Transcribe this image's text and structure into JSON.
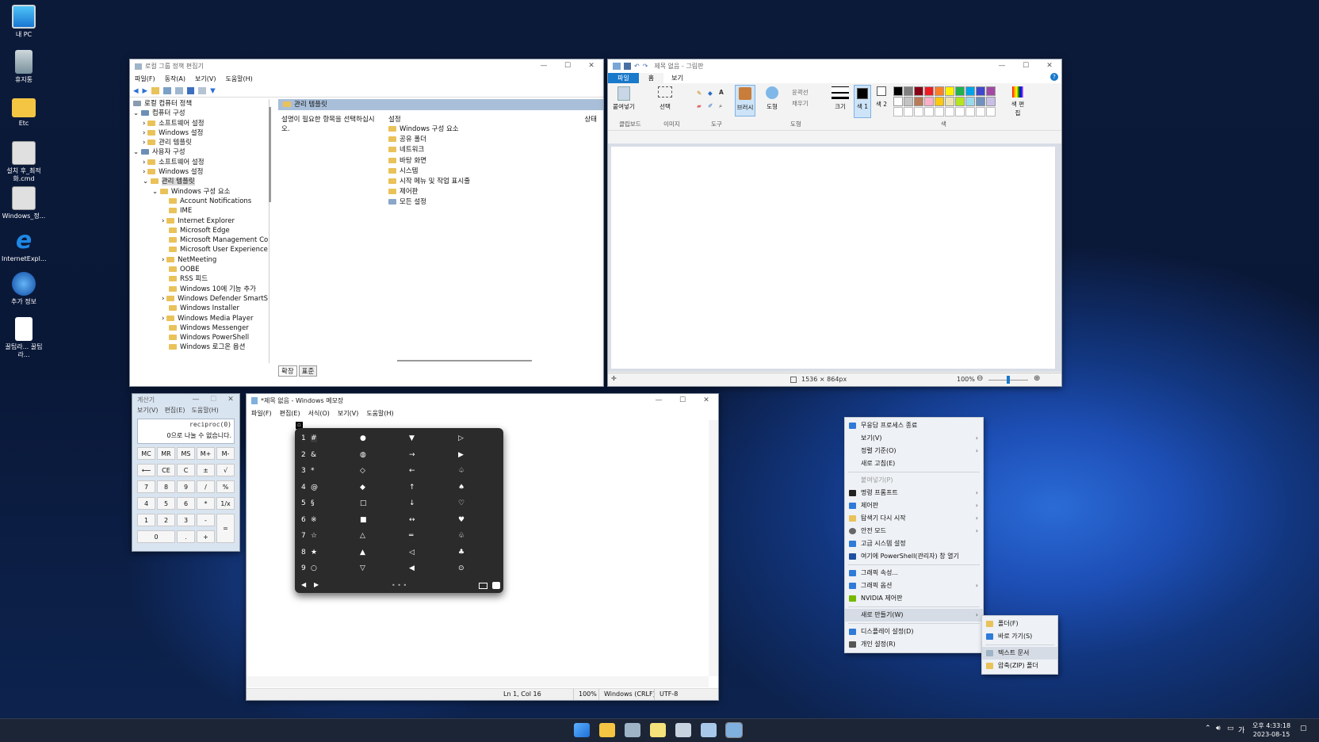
{
  "desktop": {
    "icons": [
      "내 PC",
      "휴지통",
      "Etc",
      "설치 후_최적화.cmd",
      "Windows_정...",
      "InternetExpl...",
      "추가 정보",
      "꿀팁라... 꿀팁라..."
    ]
  },
  "gpedit": {
    "title": "로컬 그룹 정책 편집기",
    "menu": [
      "파일(F)",
      "동작(A)",
      "보기(V)",
      "도움말(H)"
    ],
    "tree": [
      "로컬 컴퓨터 정책",
      "컴퓨터 구성",
      "소프트웨어 설정",
      "Windows 설정",
      "관리 템플릿",
      "사용자 구성",
      "소프트웨어 설정",
      "Windows 설정",
      "관리 템플릿",
      "Windows 구성 요소",
      "Account Notifications",
      "IME",
      "Internet Explorer",
      "Microsoft Edge",
      "Microsoft Management Co",
      "Microsoft User Experience",
      "NetMeeting",
      "OOBE",
      "RSS 피드",
      "Windows 10에 기능 추가",
      "Windows Defender SmartS",
      "Windows Installer",
      "Windows Media Player",
      "Windows Messenger",
      "Windows PowerShell",
      "Windows 로그온 옵션"
    ],
    "header": "관리 템플릿",
    "description": "설명이 필요한 항목을 선택하십시오.",
    "col_setting": "설정",
    "col_state": "상태",
    "items": [
      "Windows 구성 요소",
      "공유 폴더",
      "네트워크",
      "바탕 화면",
      "시스템",
      "시작 메뉴 및 작업 표시줄",
      "제어판",
      "모든 설정"
    ],
    "tabs": [
      "확장",
      "표준"
    ]
  },
  "paint": {
    "title": "제목 없음 - 그림판",
    "tabs": [
      "파일",
      "홈",
      "보기"
    ],
    "groups": [
      "클립보드",
      "이미지",
      "도구",
      "도형",
      "색"
    ],
    "labels": {
      "paste": "붙여넣기",
      "select": "선택",
      "brush": "브러시",
      "shape": "도형",
      "outline": "윤곽선",
      "fill": "채우기",
      "size": "크기",
      "color1": "색 1",
      "color2": "색 2",
      "edit": "색 편집"
    },
    "palette": [
      "#000000",
      "#7f7f7f",
      "#880015",
      "#ed1c24",
      "#ff7f27",
      "#fff200",
      "#22b14c",
      "#00a2e8",
      "#3f48cc",
      "#a349a4",
      "#ffffff",
      "#c3c3c3",
      "#b97a57",
      "#ffaec9",
      "#ffc90e",
      "#efe4b0",
      "#b5e61d",
      "#99d9ea",
      "#7092be",
      "#c8bfe7"
    ],
    "status": {
      "dimensions": "1536 × 864px",
      "zoom": "100%"
    }
  },
  "calc": {
    "title": "계산기",
    "menu": [
      "보기(V)",
      "편집(E)",
      "도움말(H)"
    ],
    "expr": "reciproc(0)",
    "result": "0으로 나눌 수 없습니다.",
    "keys": [
      "MC",
      "MR",
      "MS",
      "M+",
      "M-",
      "⟵",
      "CE",
      "C",
      "±",
      "√",
      "7",
      "8",
      "9",
      "/",
      "%",
      "4",
      "5",
      "6",
      "*",
      "1/x",
      "1",
      "2",
      "3",
      "-",
      "=",
      "0",
      ".",
      "+"
    ]
  },
  "notepad": {
    "title": "*제목 없음 - Windows 메모장",
    "menu": [
      "파일(F)",
      "편집(E)",
      "서식(O)",
      "보기(V)",
      "도움말(H)"
    ],
    "status": [
      "Ln 1, Col 16",
      "100%",
      "Windows (CRLF)",
      "UTF-8"
    ]
  },
  "emoji": {
    "rows": [
      [
        "1",
        "#",
        "●",
        "▼",
        "▷"
      ],
      [
        "2",
        "&",
        "◍",
        "→",
        "▶"
      ],
      [
        "3",
        "*",
        "◇",
        "←",
        "♤"
      ],
      [
        "4",
        "@",
        "◆",
        "↑",
        "♠"
      ],
      [
        "5",
        "§",
        "□",
        "↓",
        "♡"
      ],
      [
        "6",
        "※",
        "■",
        "↔",
        "♥"
      ],
      [
        "7",
        "☆",
        "△",
        "═",
        "♧"
      ],
      [
        "8",
        "★",
        "▲",
        "◁",
        "♣"
      ],
      [
        "9",
        "○",
        "▽",
        "◀",
        "⊙"
      ]
    ]
  },
  "context": {
    "items": [
      "무응답 프로세스 종료",
      "보기(V)",
      "정렬 기준(O)",
      "새로 고침(E)",
      "붙여넣기(P)",
      "명령 프롬프트",
      "제어판",
      "탐색기 다시 시작",
      "안전 모드",
      "고급 시스템 설정",
      "여기에 PowerShell(관리자) 창 열기",
      "그래픽 속성...",
      "그래픽 옵션",
      "NVIDIA 제어판",
      "새로 만들기(W)",
      "디스플레이 설정(D)",
      "개인 설정(R)"
    ],
    "submenu": [
      "폴더(F)",
      "바로 가기(S)",
      "텍스트 문서",
      "압축(ZIP) 폴더"
    ]
  },
  "taskbar": {
    "time": "오후 4:33:18",
    "date": "2023-08-15",
    "ime": "가"
  }
}
